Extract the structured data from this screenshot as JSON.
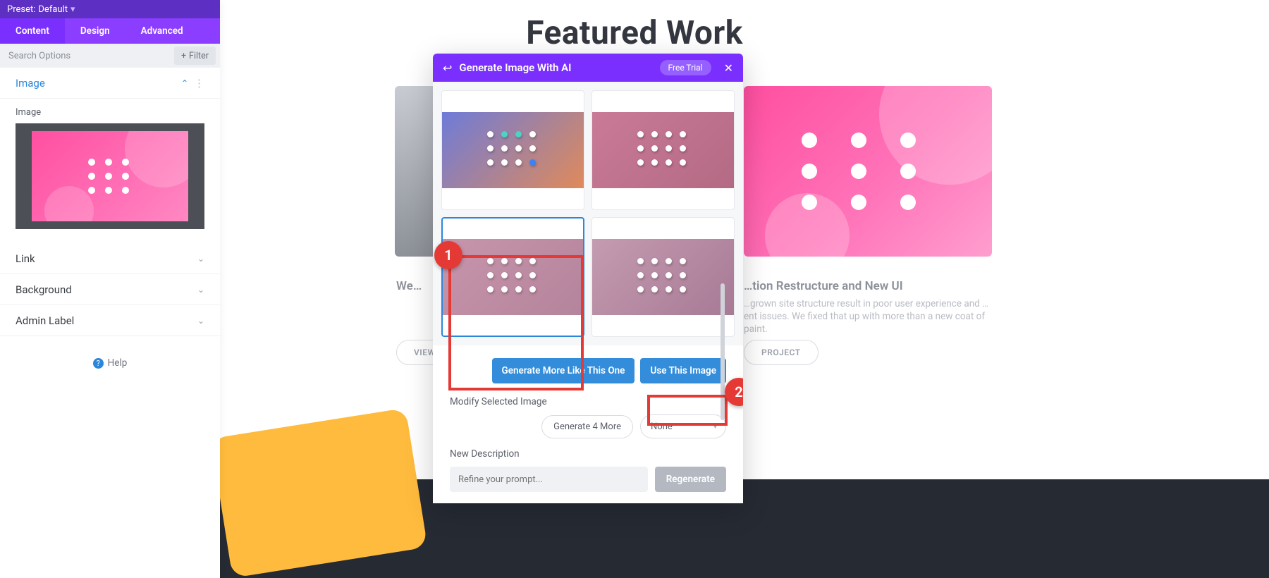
{
  "preset": {
    "label": "Preset:",
    "value": "Default"
  },
  "tabs": {
    "content": "Content",
    "design": "Design",
    "advanced": "Advanced"
  },
  "search": {
    "placeholder": "Search Options",
    "filter": "Filter"
  },
  "sections": {
    "image": "Image",
    "image_field": "Image",
    "link": "Link",
    "background": "Background",
    "admin_label": "Admin Label"
  },
  "help": "Help",
  "page": {
    "title": "Featured Work",
    "project1": {
      "title": "We…",
      "desc": ""
    },
    "project2": {
      "title": "…tion Restructure and New UI",
      "desc": "…grown site structure result in poor user experience and …ent issues. We fixed that up with more than a new coat of paint."
    },
    "view1": "VIEW",
    "view2": "PROJECT"
  },
  "modal": {
    "title": "Generate Image With AI",
    "trial": "Free Trial",
    "gen_more": "Generate More Like This One",
    "use_image": "Use This Image",
    "modify": "Modify Selected Image",
    "gen4": "Generate 4 More",
    "none": "None",
    "new_desc": "New Description",
    "prompt_placeholder": "Refine your prompt...",
    "regenerate": "Regenerate"
  },
  "callouts": {
    "one": "1",
    "two": "2"
  }
}
